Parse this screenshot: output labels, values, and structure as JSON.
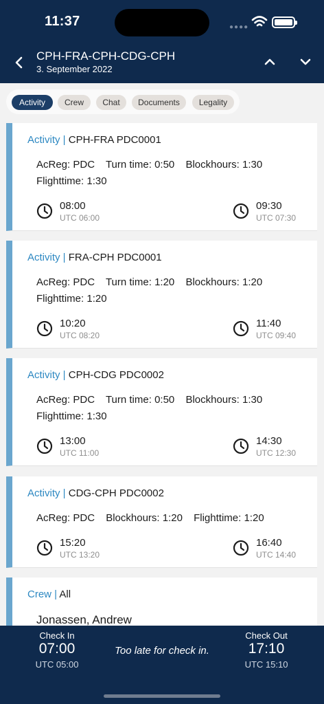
{
  "status_bar": {
    "time": "11:37"
  },
  "nav": {
    "title": "CPH-FRA-CPH-CDG-CPH",
    "date": "3. September 2022",
    "icons": [
      "chevron-left-icon",
      "chevron-up-icon",
      "chevron-down-icon"
    ]
  },
  "tabs": [
    {
      "label": "Activity",
      "active": true
    },
    {
      "label": "Crew",
      "active": false
    },
    {
      "label": "Chat",
      "active": false
    },
    {
      "label": "Documents",
      "active": false
    },
    {
      "label": "Legality",
      "active": false
    }
  ],
  "activities": [
    {
      "category": "Activity |",
      "title": "CPH-FRA PDC0001",
      "line1": [
        "AcReg: PDC",
        "Turn time: 0:50",
        "Blockhours: 1:30"
      ],
      "line2": "Flighttime: 1:30",
      "dep_time": "08:00",
      "dep_utc": "UTC 06:00",
      "arr_time": "09:30",
      "arr_utc": "UTC 07:30"
    },
    {
      "category": "Activity |",
      "title": "FRA-CPH PDC0001",
      "line1": [
        "AcReg: PDC",
        "Turn time: 1:20",
        "Blockhours: 1:20"
      ],
      "line2": "Flighttime: 1:20",
      "dep_time": "10:20",
      "dep_utc": "UTC 08:20",
      "arr_time": "11:40",
      "arr_utc": "UTC 09:40"
    },
    {
      "category": "Activity |",
      "title": "CPH-CDG PDC0002",
      "line1": [
        "AcReg: PDC",
        "Turn time: 0:50",
        "Blockhours: 1:30"
      ],
      "line2": "Flighttime: 1:30",
      "dep_time": "13:00",
      "dep_utc": "UTC 11:00",
      "arr_time": "14:30",
      "arr_utc": "UTC 12:30"
    },
    {
      "category": "Activity |",
      "title": "CDG-CPH PDC0002",
      "line1": [
        "AcReg: PDC",
        "Blockhours: 1:20",
        "Flighttime: 1:20"
      ],
      "line2": "",
      "dep_time": "15:20",
      "dep_utc": "UTC 13:20",
      "arr_time": "16:40",
      "arr_utc": "UTC 14:40"
    }
  ],
  "crew": {
    "category": "Crew |",
    "filter": "All",
    "first_member": "Jonassen, Andrew"
  },
  "footer": {
    "check_in_label": "Check In",
    "check_in_time": "07:00",
    "check_in_utc": "UTC 05:00",
    "message": "Too late for check in.",
    "check_out_label": "Check Out",
    "check_out_time": "17:10",
    "check_out_utc": "UTC 15:10"
  },
  "colors": {
    "header_bg": "#0f2a4d",
    "accent_bar": "#6aa6ce",
    "category_text": "#2d88c2",
    "active_tab": "#1c3e67"
  }
}
